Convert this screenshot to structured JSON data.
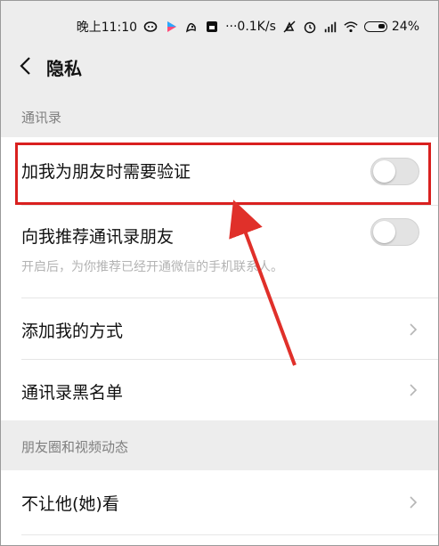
{
  "status_bar": {
    "time": "晚上11:10",
    "net_speed": "···0.1K/s",
    "battery": "24%",
    "icons": [
      "chat-bubble-icon",
      "play-icon",
      "app-icon",
      "sim-card-icon",
      "mute-icon",
      "alarm-icon",
      "signal-icon",
      "wifi-icon",
      "battery-icon"
    ]
  },
  "header": {
    "title": "隐私",
    "back_icon": "chevron-left-icon"
  },
  "sections": [
    {
      "title": "通讯录",
      "items": [
        {
          "label": "加我为朋友时需要验证",
          "control": "toggle",
          "on": false,
          "highlighted": true
        },
        {
          "label": "向我推荐通讯录朋友",
          "sub": "开启后，为你推荐已经开通微信的手机联系人。",
          "control": "toggle",
          "on": false
        },
        {
          "label": "添加我的方式",
          "control": "chevron"
        },
        {
          "label": "通讯录黑名单",
          "control": "chevron"
        }
      ]
    },
    {
      "title": "朋友圈和视频动态",
      "items": [
        {
          "label": "不让他(她)看",
          "control": "chevron"
        }
      ]
    }
  ],
  "colors": {
    "background": "#ededed",
    "cell": "#ffffff",
    "section_text": "#7f7f7f",
    "highlight": "#d9201f",
    "toggle_off": "#e3e3e3"
  }
}
